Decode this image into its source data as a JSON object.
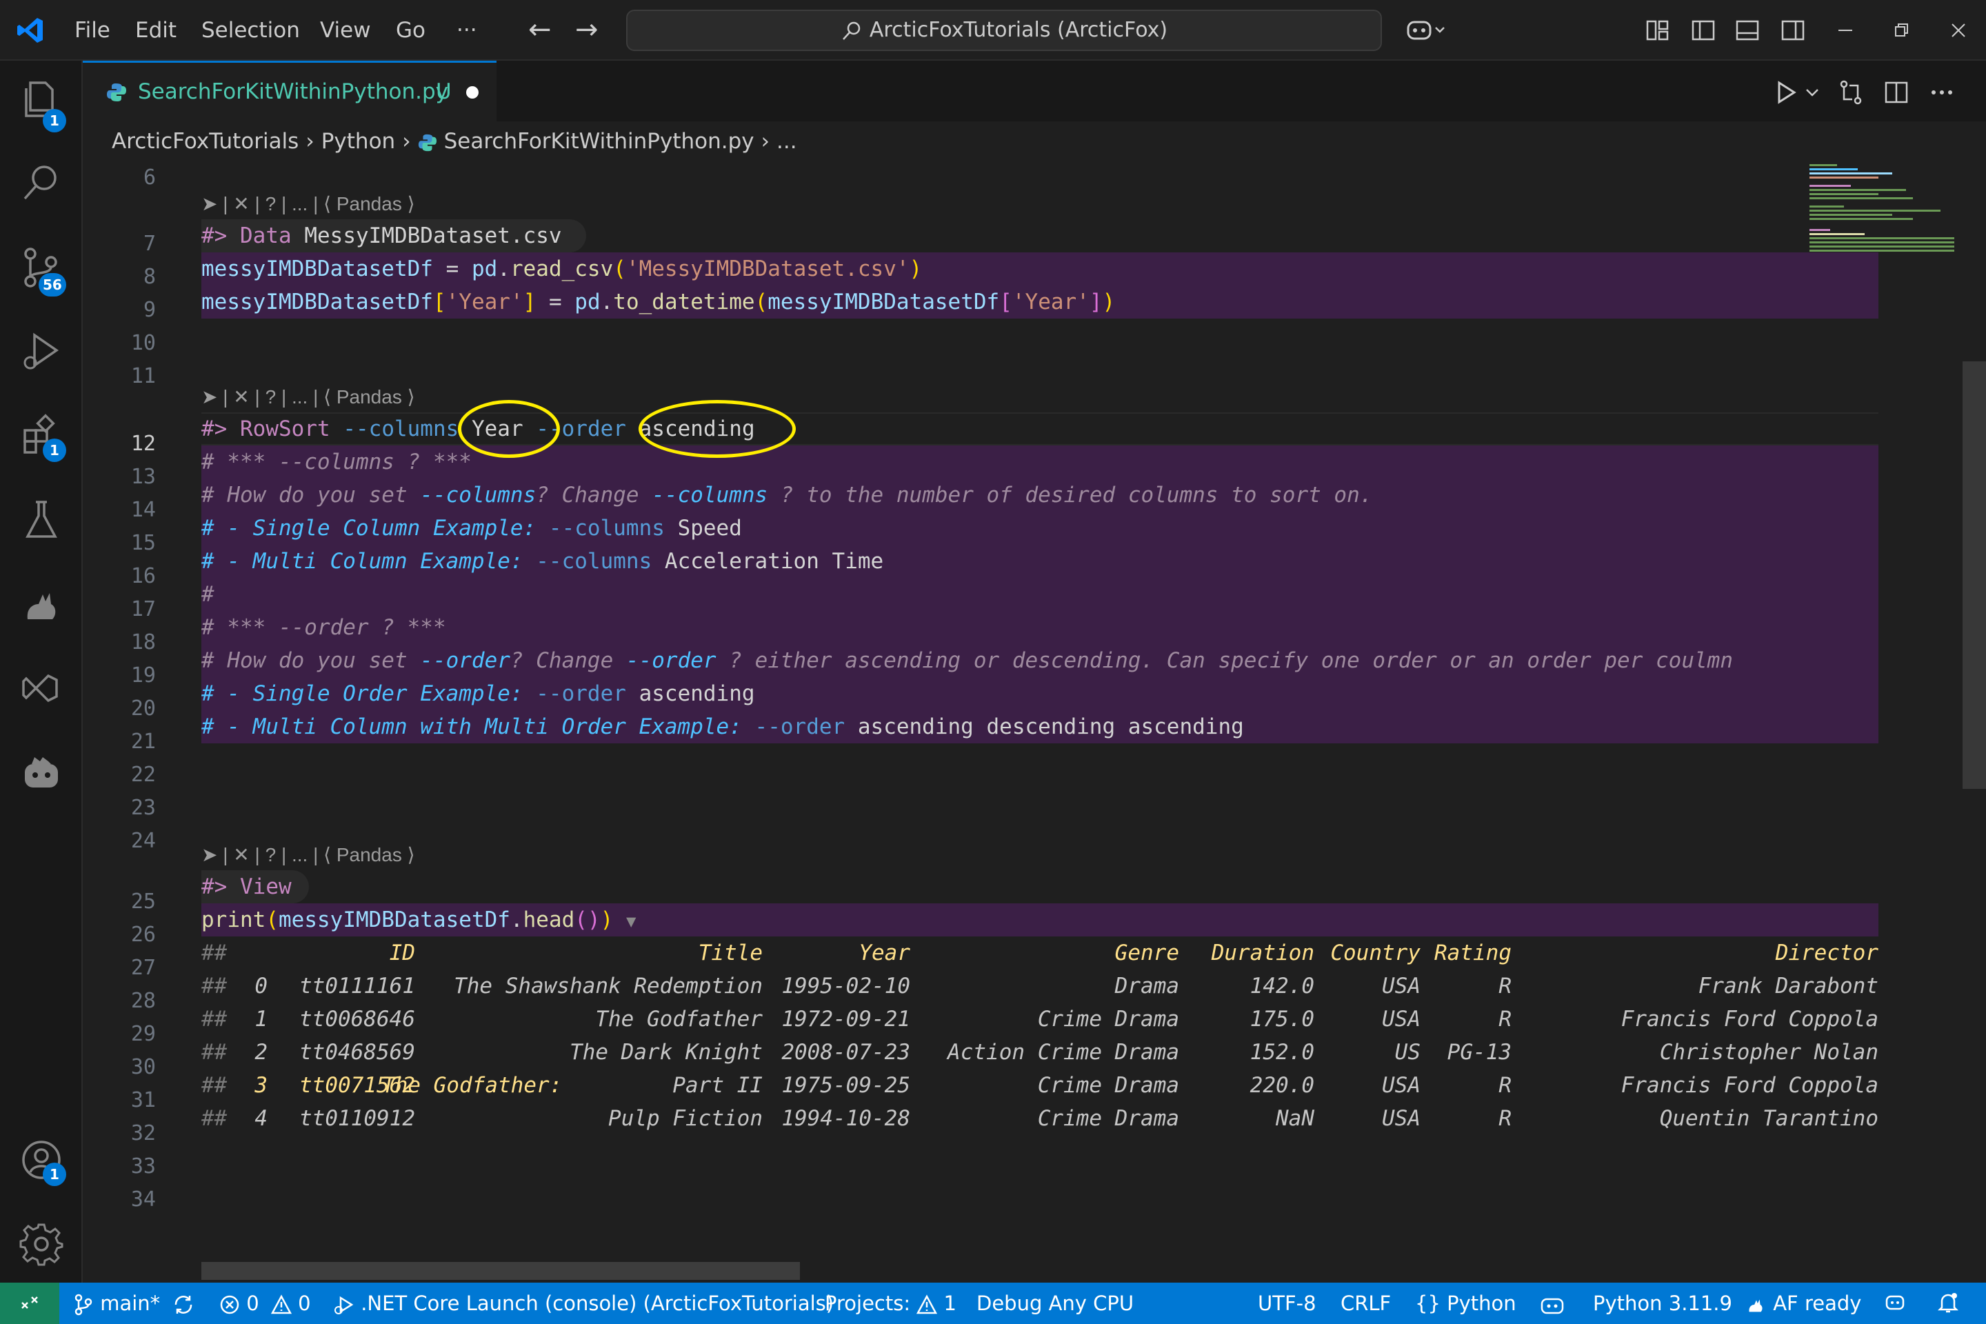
{
  "titlebar": {
    "menu": [
      "File",
      "Edit",
      "Selection",
      "View",
      "Go",
      "···"
    ],
    "search_text": "ArcticFoxTutorials (ArcticFox)",
    "back": "←",
    "forward": "→"
  },
  "activity": {
    "explorer_badge": "1",
    "scm_badge": "56",
    "extensions_badge": "1",
    "accounts_badge": "1"
  },
  "tab": {
    "filename": "SearchForKitWithinPython.py",
    "status": "U"
  },
  "breadcrumb": {
    "items": [
      "ArcticFoxTutorials",
      "Python",
      "SearchForKitWithinPython.py",
      "..."
    ]
  },
  "editor": {
    "line_numbers": [
      "6",
      "7",
      "8",
      "9",
      "10",
      "11",
      "12",
      "13",
      "14",
      "15",
      "16",
      "17",
      "18",
      "19",
      "20",
      "21",
      "22",
      "23",
      "24",
      "25",
      "26",
      "27",
      "28",
      "29",
      "30",
      "31",
      "32",
      "33",
      "34"
    ],
    "codelens": "➤ | ✕ | ? | ... | ⟨ Pandas ⟩",
    "lines": {
      "l7_prefix": "#>",
      "l7_kw": "Data",
      "l7_arg": "MessyIMDBDataset.csv",
      "l8_var": "messyIMDBDatasetDf",
      "l8_eq": " = ",
      "l8_mod": "pd",
      "l8_fn": "read_csv",
      "l8_str": "'MessyIMDBDataset.csv'",
      "l9_var": "messyIMDBDatasetDf",
      "l9_key": "'Year'",
      "l9_mod": "pd",
      "l9_fn": "to_datetime",
      "l12_prefix": "#>",
      "l12_kw": "RowSort",
      "l12_opt1": "--columns",
      "l12_val1": "Year",
      "l12_opt2": "--order",
      "l12_val2": "ascending",
      "l13": "# *** --columns ? ***",
      "l14a": "# How do you set ",
      "l14b": "--columns",
      "l14c": "? Change ",
      "l14d": "--columns",
      "l14e": " ? to the number of desired columns to sort on.",
      "l15a": "# - Single Column Example: ",
      "l15b": "--columns",
      "l15c": " Speed",
      "l16a": "# - Multi Column Example: ",
      "l16b": "--columns",
      "l16c": " Acceleration Time",
      "l17": "#",
      "l18": "# *** --order ? ***",
      "l19a": "# How do you set ",
      "l19b": "--order",
      "l19c": "? Change ",
      "l19d": "--order",
      "l19e": " ? either ascending or descending. Can specify one order or an order per coulmn",
      "l20a": "# - Single Order Example: ",
      "l20b": "--order",
      "l20c": " ascending",
      "l21a": "# - Multi Column with Multi Order Example: ",
      "l21b": "--order",
      "l21c": " ascending descending ascending",
      "l25_prefix": "#>",
      "l25_kw": "View",
      "l26_fn": "print",
      "l26_var": "messyIMDBDatasetDf",
      "l26_meth": "head",
      "l26_fold": "▼"
    },
    "output": {
      "prefix": "##",
      "headers": [
        "ID",
        "Title",
        "Year",
        "Genre",
        "Duration",
        "Country",
        "Rating",
        "Director"
      ],
      "rows": [
        [
          "0",
          "tt0111161",
          "The Shawshank Redemption",
          "1995-02-10",
          "Drama",
          "142.0",
          "USA",
          "R",
          "Frank Darabont"
        ],
        [
          "1",
          "tt0068646",
          "The Godfather",
          "1972-09-21",
          "Crime Drama",
          "175.0",
          "USA",
          "R",
          "Francis Ford Coppola"
        ],
        [
          "2",
          "tt0468569",
          "The Dark Knight",
          "2008-07-23",
          "Action Crime Drama",
          "152.0",
          "US",
          "PG-13",
          "Christopher Nolan"
        ],
        [
          "3",
          "tt0071562",
          "The Godfather:",
          "Part II",
          "1975-09-25",
          "Crime Drama",
          "220.0",
          "USA",
          "R",
          "Francis Ford Coppola"
        ],
        [
          "4",
          "tt0110912",
          "Pulp Fiction",
          "1994-10-28",
          "Crime Drama",
          "NaN",
          "USA",
          "R",
          "Quentin Tarantino"
        ]
      ]
    }
  },
  "statusbar": {
    "branch": "main*",
    "errors": "0",
    "warnings": "0",
    "launch": ".NET Core Launch (console) (ArcticFoxTutorials)",
    "projects": "Projects:",
    "projects_count": "1",
    "debug": "Debug Any CPU",
    "encoding": "UTF-8",
    "eol": "CRLF",
    "language": "Python",
    "interpreter": "Python 3.11.9",
    "af": "AF ready"
  }
}
